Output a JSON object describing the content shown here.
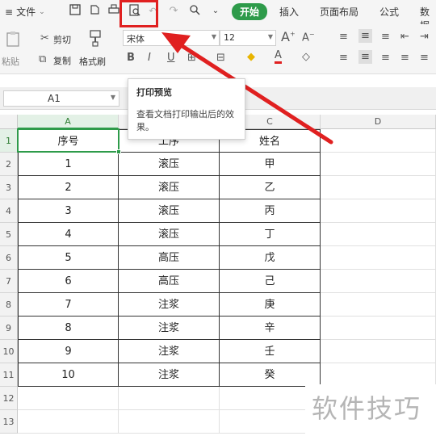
{
  "menu": {
    "file_label": "文件",
    "tabs": [
      "开始",
      "插入",
      "页面布局",
      "公式",
      "数据"
    ]
  },
  "ribbon": {
    "paste_label": "粘贴",
    "cut_label": "剪切",
    "copy_label": "复制",
    "format_painter_label": "格式刷",
    "font_name": "宋体",
    "font_size": "12"
  },
  "tooltip": {
    "title": "打印预览",
    "body": "查看文档打印输出后的效果。"
  },
  "formula_bar": {
    "cell_ref": "A1"
  },
  "sheet": {
    "columns": [
      "A",
      "B",
      "C",
      "D"
    ],
    "rows": [
      "1",
      "2",
      "3",
      "4",
      "5",
      "6",
      "7",
      "8",
      "9",
      "10",
      "11",
      "12",
      "13"
    ],
    "header": [
      "序号",
      "工序",
      "姓名"
    ],
    "data": [
      [
        "1",
        "滚压",
        "甲"
      ],
      [
        "2",
        "滚压",
        "乙"
      ],
      [
        "3",
        "滚压",
        "丙"
      ],
      [
        "4",
        "滚压",
        "丁"
      ],
      [
        "5",
        "高压",
        "戊"
      ],
      [
        "6",
        "高压",
        "己"
      ],
      [
        "7",
        "注浆",
        "庚"
      ],
      [
        "8",
        "注浆",
        "辛"
      ],
      [
        "9",
        "注浆",
        "壬"
      ],
      [
        "10",
        "注浆",
        "癸"
      ]
    ]
  },
  "watermark": "软件技巧",
  "colors": {
    "accent": "#2e9b4a",
    "annotation": "#e02020"
  }
}
